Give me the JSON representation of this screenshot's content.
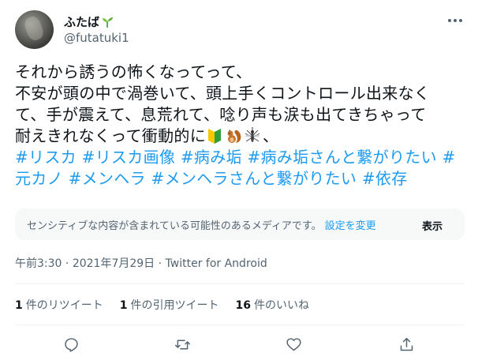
{
  "user": {
    "display_name": "ふたば",
    "handle": "@futatuki1"
  },
  "tweet": {
    "line1": "それから誘うの怖くなってって、",
    "line2": "不安が頭の中で渦巻いて、頭上手くコントロール出来なく",
    "line3": "て、手が震えて、息荒れて、唸り声も涙も出てきちゃって",
    "line4_text": "耐えきれなくって衝動的に",
    "line4_tail": "、",
    "hashtags": {
      "h1": "#リスカ",
      "h2": "#リスカ画像",
      "h3": "#病み垢",
      "h4": "#病み垢さんと繋がりたい",
      "h5": "#",
      "h5b": "元カノ",
      "h6": "#メンヘラ",
      "h7": "#メンヘラさんと繋がりたい",
      "h8": "#依存"
    },
    "emojis": [
      "beginner-mark-icon",
      "squirrel-icon",
      "mosquito-icon"
    ]
  },
  "sensitive": {
    "notice": "センシティブな内容が含まれている可能性のあるメディアです。",
    "settings_link": "設定を変更",
    "show_label": "表示"
  },
  "meta": {
    "time": "午前3:30",
    "sep1": " · ",
    "date": "2021年7月29日",
    "sep2": " · ",
    "source": "Twitter for Android"
  },
  "stats": {
    "retweets_count": "1",
    "retweets_label": "件のリツイート",
    "quotes_count": "1",
    "quotes_label": "件の引用ツイート",
    "likes_count": "16",
    "likes_label": "件のいいね"
  },
  "colors": {
    "link": "#1d9bf0",
    "secondary": "#536471",
    "text": "#0f1419"
  }
}
